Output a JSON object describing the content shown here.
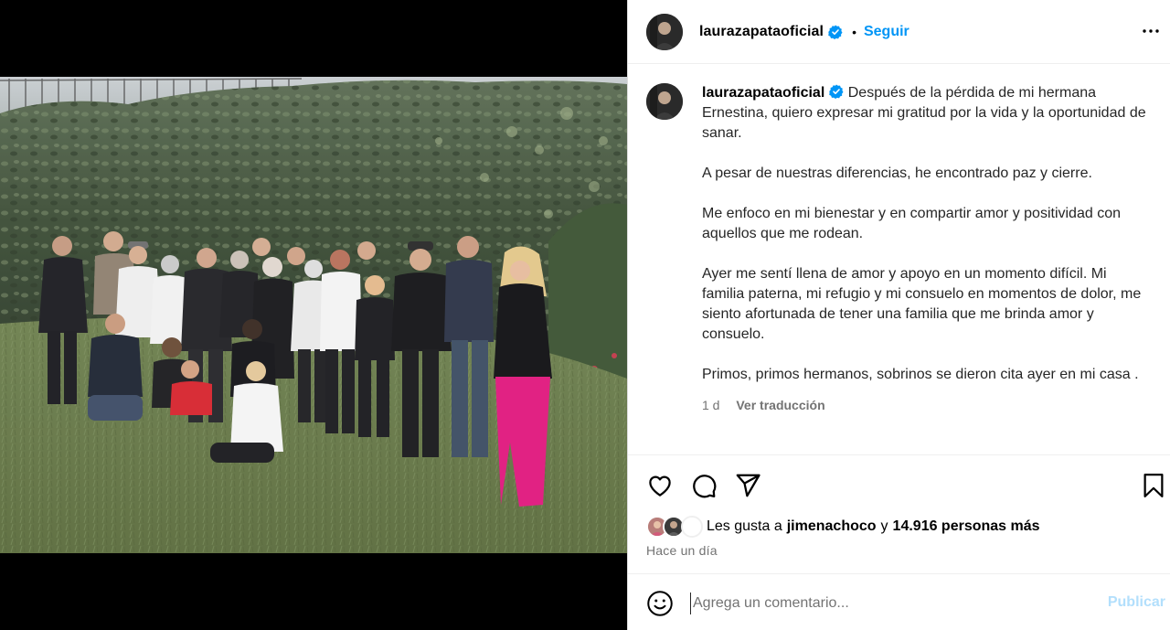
{
  "header": {
    "username": "laurazapataoficial",
    "separator": "•",
    "follow_label": "Seguir",
    "more_icon": "more-horizontal-icon"
  },
  "caption": {
    "username": "laurazapataoficial",
    "paragraphs": [
      "Después de la pérdida de mi hermana Ernestina, quiero expresar mi gratitud por la vida y la oportunidad de sanar.",
      "A pesar de nuestras diferencias, he encontrado paz y cierre.",
      "Me enfoco en mi bienestar y en compartir amor y positividad con aquellos que me rodean.",
      "Ayer me sentí llena de amor y apoyo en un momento difícil. Mi familia paterna, mi refugio y mi consuelo en momentos de dolor, me siento afortunada de tener una familia que me brinda amor y consuelo.",
      "Primos, primos hermanos, sobrinos se dieron cita ayer en mi casa ."
    ],
    "time": "1 d",
    "translate_label": "Ver traducción"
  },
  "actions": {
    "like_icon": "heart-icon",
    "comment_icon": "comment-icon",
    "share_icon": "send-icon",
    "save_icon": "bookmark-icon"
  },
  "likes": {
    "prefix": "Les gusta a",
    "first_user": "jimenachoco",
    "conjunction": "y",
    "others": "14.916 personas más"
  },
  "posted_ago": "Hace un día",
  "comment": {
    "placeholder": "Agrega un comentario...",
    "publish_label": "Publicar",
    "emoji_icon": "emoji-icon"
  },
  "colors": {
    "accent": "#0095f6",
    "verified": "#0095f6",
    "muted": "#737373",
    "publish_disabled": "#b2dffc"
  }
}
